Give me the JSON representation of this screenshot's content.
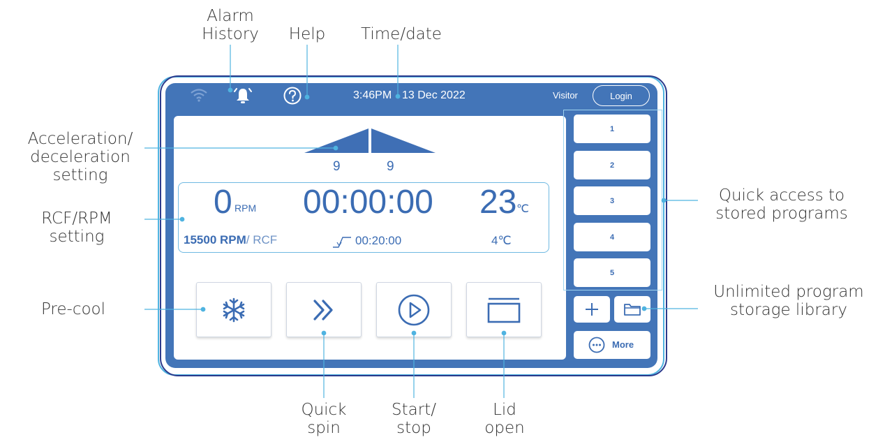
{
  "annotations": {
    "alarm_history": [
      "Alarm",
      "History"
    ],
    "help": "Help",
    "time_date": "Time/date",
    "accel_decel": [
      "Acceleration/",
      "deceleration",
      "setting"
    ],
    "rcf_rpm": [
      "RCF/RPM",
      "setting"
    ],
    "pre_cool": "Pre-cool",
    "quick_spin": [
      "Quick",
      "spin"
    ],
    "start_stop": [
      "Start/",
      "stop"
    ],
    "lid_open": [
      "Lid",
      "open"
    ],
    "quick_access": [
      "Quick access to",
      "stored programs"
    ],
    "program_library": [
      "Unlimited program",
      "storage library"
    ]
  },
  "screen": {
    "status_bar": {
      "time": "3:46PM",
      "date": "13 Dec 2022",
      "user": "Visitor",
      "login_label": "Login"
    },
    "accel_value": "9",
    "decel_value": "9",
    "speed": {
      "value": "0",
      "unit": "RPM",
      "setpoint_value": "15500",
      "setpoint_unit": "RPM",
      "setpoint_alt": "/ RCF"
    },
    "timer": {
      "value": "00:00:00",
      "setpoint": "00:20:00"
    },
    "temperature": {
      "value": "23",
      "unit": "℃",
      "setpoint": "4℃"
    },
    "programs": [
      "1",
      "2",
      "3",
      "4",
      "5"
    ],
    "more_label": "More"
  },
  "colors": {
    "screen_blue": "#4375b8",
    "text_blue": "#3b6cb3",
    "leader_line": "#4fb3e0"
  },
  "icons": [
    "wifi-icon",
    "bell-icon",
    "help-icon",
    "snowflake-icon",
    "quick-spin-icon",
    "play-icon",
    "lid-icon",
    "plus-icon",
    "folder-icon",
    "more-icon"
  ]
}
